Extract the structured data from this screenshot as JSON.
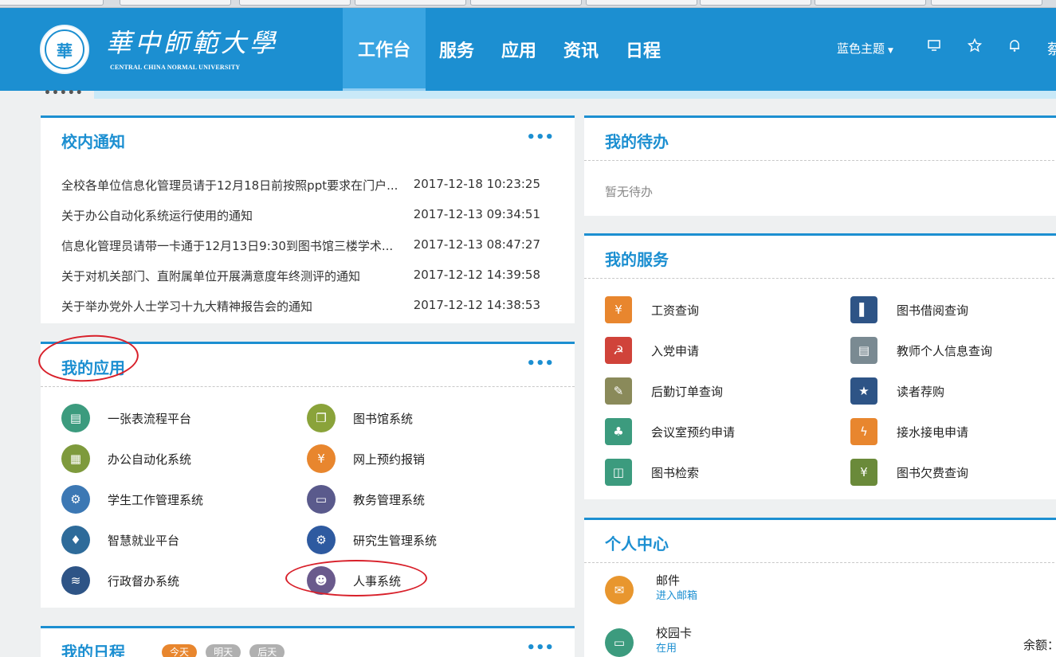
{
  "header": {
    "logo_text": "華中師範大學",
    "logo_en": "CENTRAL CHINA NORMAL UNIVERSITY",
    "nav": [
      {
        "label": "工作台",
        "active": true
      },
      {
        "label": "服务",
        "active": false
      },
      {
        "label": "应用",
        "active": false
      },
      {
        "label": "资讯",
        "active": false
      },
      {
        "label": "日程",
        "active": false
      }
    ],
    "theme_label": "蓝色主题",
    "user_name_partial": "蔡",
    "colors": {
      "brand": "#1c8fd1",
      "active_nav": "#3aa5e2"
    }
  },
  "notices": {
    "title": "校内通知",
    "more": "•••",
    "items": [
      {
        "title": "全校各单位信息化管理员请于12月18日前按照ppt要求在门户...",
        "time": "2017-12-18 10:23:25"
      },
      {
        "title": "关于办公自动化系统运行使用的通知",
        "time": "2017-12-13 09:34:51"
      },
      {
        "title": "信息化管理员请带一卡通于12月13日9:30到图书馆三楼学术...",
        "time": "2017-12-13 08:47:27"
      },
      {
        "title": "关于对机关部门、直附属单位开展满意度年终测评的通知",
        "time": "2017-12-12 14:39:58"
      },
      {
        "title": "关于举办党外人士学习十九大精神报告会的通知",
        "time": "2017-12-12 14:38:53"
      }
    ]
  },
  "my_apps": {
    "title": "我的应用",
    "more": "•••",
    "items": [
      {
        "label": "一张表流程平台",
        "icon": "form-table-icon",
        "color": "#3c9b7e",
        "glyph": "▤"
      },
      {
        "label": "图书馆系统",
        "icon": "library-book-icon",
        "color": "#8aa33a",
        "glyph": "❐"
      },
      {
        "label": "办公自动化系统",
        "icon": "office-doc-icon",
        "color": "#7e9a3c",
        "glyph": "▦"
      },
      {
        "label": "网上预约报销",
        "icon": "reimburse-icon",
        "color": "#e8862e",
        "glyph": "¥"
      },
      {
        "label": "学生工作管理系统",
        "icon": "student-settings-icon",
        "color": "#3c78b4",
        "glyph": "⚙"
      },
      {
        "label": "教务管理系统",
        "icon": "teaching-icon",
        "color": "#5a5a8c",
        "glyph": "▭"
      },
      {
        "label": "智慧就业平台",
        "icon": "tie-icon",
        "color": "#2e6b9a",
        "glyph": "♦"
      },
      {
        "label": "研究生管理系统",
        "icon": "grad-settings-icon",
        "color": "#2e5aa0",
        "glyph": "⚙"
      },
      {
        "label": "行政督办系统",
        "icon": "layers-icon",
        "color": "#2e5486",
        "glyph": "≋"
      },
      {
        "label": "人事系统",
        "icon": "person-icon",
        "color": "#6a5a8c",
        "glyph": "☻"
      }
    ]
  },
  "schedule": {
    "title": "我的日程",
    "more": "•••",
    "tags": [
      "今天",
      "明天",
      "后天"
    ]
  },
  "todo": {
    "title": "我的待办",
    "empty_text": "暂无待办"
  },
  "my_services": {
    "title": "我的服务",
    "items": [
      {
        "label": "工资查询",
        "icon": "salary-ticket-icon",
        "color": "#e8862e",
        "glyph": "¥"
      },
      {
        "label": "图书借阅查询",
        "icon": "book-borrow-icon",
        "color": "#2e5486",
        "glyph": "▌"
      },
      {
        "label": "入党申请",
        "icon": "party-emblem-icon",
        "color": "#d0433a",
        "glyph": "☭"
      },
      {
        "label": "教师个人信息查询",
        "icon": "id-card-icon",
        "color": "#7a8a92",
        "glyph": "▤"
      },
      {
        "label": "后勤订单查询",
        "icon": "order-list-icon",
        "color": "#8a8a5a",
        "glyph": "✎"
      },
      {
        "label": "读者荐购",
        "icon": "bookmark-star-icon",
        "color": "#2e5486",
        "glyph": "★"
      },
      {
        "label": "会议室预约申请",
        "icon": "meeting-icon",
        "color": "#3c9b7e",
        "glyph": "♣"
      },
      {
        "label": "接水接电申请",
        "icon": "power-drop-icon",
        "color": "#e8862e",
        "glyph": "ϟ"
      },
      {
        "label": "图书检索",
        "icon": "open-book-icon",
        "color": "#3c9b7e",
        "glyph": "◫"
      },
      {
        "label": "图书欠费查询",
        "icon": "fee-coin-icon",
        "color": "#6a8a3a",
        "glyph": "¥"
      }
    ]
  },
  "personal_center": {
    "title": "个人中心",
    "items": [
      {
        "name": "邮件",
        "sub": "进入邮箱",
        "icon": "mail-icon",
        "color": "#e8962e",
        "glyph": "✉"
      },
      {
        "name": "校园卡",
        "sub": "在用",
        "icon": "campus-card-icon",
        "color": "#3c9b7e",
        "glyph": "▭"
      }
    ],
    "balance_label": "余额："
  }
}
